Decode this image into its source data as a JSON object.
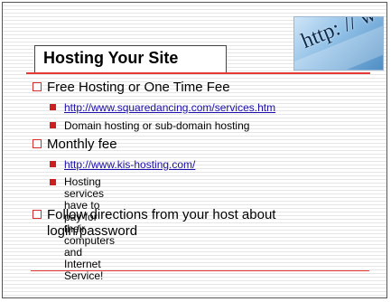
{
  "slide": {
    "title": "Hosting Your Site",
    "image_text": "http: // www",
    "colors": {
      "accent": "#e53935",
      "bullet": "#cc1f1f",
      "link": "#1a0dab"
    },
    "bullets": [
      {
        "text": "Free Hosting or One Time Fee",
        "sub": [
          {
            "text": "http://www.squaredancing.com/services.htm",
            "link": true
          },
          {
            "text": "Domain hosting or sub-domain hosting",
            "link": false
          }
        ]
      },
      {
        "text": "Monthly fee",
        "sub": [
          {
            "text": "http://www.kis-hosting.com/",
            "link": true
          },
          {
            "line1": "Hosting services have to pay for their",
            "line2": "computers and Internet Service!",
            "link": false
          }
        ]
      },
      {
        "line1": "Follow directions from your host about",
        "line2": "login/password"
      }
    ]
  }
}
